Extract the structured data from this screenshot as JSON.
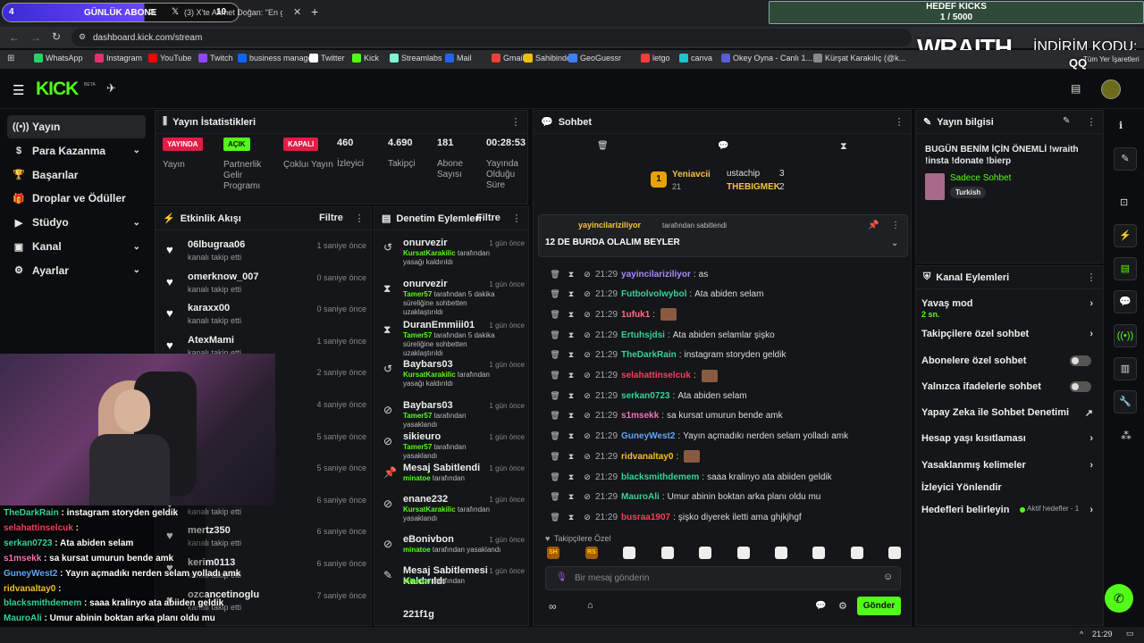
{
  "browser": {
    "tabs": [
      {
        "label": "GÜNLÜK ABONE"
      },
      {
        "label": "(3) X'te Ahmet Doğan: \"En gü..."
      }
    ],
    "overlay_left_num": "4",
    "overlay_right_num": "10",
    "new_tab": "+",
    "url": "dashboard.kick.com/stream",
    "bookmarks": [
      "WhatsApp",
      "Instagram",
      "YouTube",
      "Twitch",
      "business manager",
      "Twitter",
      "Kick",
      "Streamlabs",
      "Mail",
      "Gmail",
      "Sahibinden",
      "GeoGuessr",
      "letgo",
      "canva",
      "Okey Oyna - Canlı 1...",
      "Kürşat Karakılıç (@k..."
    ],
    "bookmarks_right": "Tüm Yer İşaretleri"
  },
  "stream_overlay": {
    "goal_title": "HEDEF KICKS",
    "goal_value": "1 / 5000",
    "brand": "WRAITH.",
    "discount_label": "İNDİRİM KODU:",
    "discount_code": "QQ"
  },
  "kick": {
    "logo": "KICK",
    "beta": "BETA"
  },
  "nav": [
    {
      "label": "Yayın",
      "icon": "((•))",
      "chev": false
    },
    {
      "label": "Para Kazanma",
      "icon": "$",
      "chev": true
    },
    {
      "label": "Başarılar",
      "icon": "🏆",
      "chev": false
    },
    {
      "label": "Droplar ve Ödüller",
      "icon": "🎁",
      "chev": false
    },
    {
      "label": "Stüdyo",
      "icon": "▶",
      "chev": true
    },
    {
      "label": "Kanal",
      "icon": "▣",
      "chev": true
    },
    {
      "label": "Ayarlar",
      "icon": "⚙",
      "chev": true
    }
  ],
  "stats": {
    "title": "Yayın İstatistikleri",
    "items": [
      {
        "badge": "YAYINDA",
        "label": "Yayın"
      },
      {
        "badge": "AÇIK",
        "label": "Partnerlik Gelir Programı"
      },
      {
        "badge": "KAPALI",
        "label": "Çokluı Yayın"
      },
      {
        "value": "460",
        "label": "İzleyici"
      },
      {
        "value": "4.690",
        "label": "Takipçi"
      },
      {
        "value": "181",
        "label": "Abone Sayısı"
      },
      {
        "value": "00:28:53",
        "label": "Yayında Olduğu Süre"
      }
    ]
  },
  "activity": {
    "title": "Etkinlik Akışı",
    "filter": "Filtre",
    "items": [
      {
        "name": "06lbugraa06",
        "sub": "kanalı takip etti",
        "time": "1 saniye önce"
      },
      {
        "name": "omerknow_007",
        "sub": "kanalı takip etti",
        "time": "0 saniye önce"
      },
      {
        "name": "karaxx00",
        "sub": "kanalı takip etti",
        "time": "0 saniye önce"
      },
      {
        "name": "AtexMami",
        "sub": "kanalı takip etti",
        "time": "1 saniye önce"
      },
      {
        "name": "",
        "sub": "",
        "time": "2 saniye önce"
      },
      {
        "name": "",
        "sub": "",
        "time": "4 saniye önce"
      },
      {
        "name": "",
        "sub": "",
        "time": "5 saniye önce"
      },
      {
        "name": "",
        "sub": "",
        "time": "5 saniye önce"
      },
      {
        "name": "",
        "sub": "kanalı takip etti",
        "time": "6 saniye önce"
      },
      {
        "name": "mertz350",
        "sub": "kanalı takip etti",
        "time": "6 saniye önce"
      },
      {
        "name": "kerim0113",
        "sub": "kanalı takip etti",
        "time": "6 saniye önce"
      },
      {
        "name": "ozcancetinoglu",
        "sub": "kanalı takip etti",
        "time": "7 saniye önce"
      }
    ]
  },
  "mod": {
    "title": "Denetim Eylemleri",
    "filter": "Filtre",
    "items": [
      {
        "icon": "↺",
        "name": "onurvezir",
        "by": "KursatKarakilic",
        "desc": " tarafından yasağı kaldırıldı",
        "time": "1 gün önce"
      },
      {
        "icon": "⧗",
        "name": "onurvezir",
        "by": "Tamer57",
        "desc": " tarafından 5 dakika süreliğine sohbetten uzaklaştırıldı",
        "time": "1 gün önce"
      },
      {
        "icon": "⧗",
        "name": "DuranEmmiii01",
        "by": "Tamer57",
        "desc": " tarafından 5 dakika süreliğine sohbetten uzaklaştırıldı",
        "time": "1 gün önce"
      },
      {
        "icon": "↺",
        "name": "Baybars03",
        "by": "KursatKarakilic",
        "desc": " tarafından yasağı kaldırıldı",
        "time": "1 gün önce"
      },
      {
        "icon": "⊘",
        "name": "Baybars03",
        "by": "Tamer57",
        "desc": " tarafından yasaklandı",
        "time": "1 gün önce"
      },
      {
        "icon": "⊘",
        "name": "sikieuro",
        "by": "Tamer57",
        "desc": " tarafından yasaklandı",
        "time": "1 gün önce"
      },
      {
        "icon": "📌",
        "name": "Mesaj Sabitlendi",
        "by": "minatoe",
        "desc": " tarafından",
        "time": "1 gün önce"
      },
      {
        "icon": "⊘",
        "name": "enane232",
        "by": "KursatKarakilic",
        "desc": " tarafından yasaklandı",
        "time": "1 gün önce"
      },
      {
        "icon": "⊘",
        "name": "eBonivbon",
        "by": "minatoe",
        "desc": " tarafından yasaklandı",
        "time": "1 gün önce"
      },
      {
        "icon": "✎",
        "name": "Mesaj Sabitlemesi Kaldırıldı",
        "by": "minatoe",
        "desc": " tarafından",
        "time": "1 gün önce"
      },
      {
        "icon": "",
        "name": "221f1g",
        "by": "",
        "desc": "",
        "time": ""
      }
    ]
  },
  "chat": {
    "title": "Sohbet",
    "leaderboard": [
      {
        "rank": "1",
        "name": "Yeniavcii",
        "count": "21"
      },
      {
        "name": "ustachip",
        "count": "3"
      },
      {
        "name": "THEBIGMEK",
        "count": "2"
      }
    ],
    "pinned_by": "yayincilariziliyor",
    "pinned_suffix": "tarafından sabitlendi",
    "pinned_msg": "12 DE BURDA OLALIM BEYLER",
    "messages": [
      {
        "time": "21:29",
        "user": "yayincilariziliyor",
        "color": "#a78bfa",
        "text": "as",
        "emote": false
      },
      {
        "time": "21:29",
        "user": "Futbolvolwybol",
        "color": "#34d399",
        "text": "Ata abiden selam",
        "emote": false
      },
      {
        "time": "21:29",
        "user": "1ufuk1",
        "color": "#fb7185",
        "text": "",
        "emote": true
      },
      {
        "time": "21:29",
        "user": "Ertuhsjdsi",
        "color": "#34d399",
        "text": "Ata abiden selamlar şişko",
        "emote": false
      },
      {
        "time": "21:29",
        "user": "TheDarkRain",
        "color": "#34d399",
        "text": "instagram storyden geldik",
        "emote": false
      },
      {
        "time": "21:29",
        "user": "selahattinselcuk",
        "color": "#f43f5e",
        "text": "",
        "emote": true
      },
      {
        "time": "21:29",
        "user": "serkan0723",
        "color": "#34d399",
        "text": "Ata abiden selam",
        "emote": false
      },
      {
        "time": "21:29",
        "user": "s1msekk",
        "color": "#f472b6",
        "text": "sa kursat umurun bende amk",
        "emote": false
      },
      {
        "time": "21:29",
        "user": "GuneyWest2",
        "color": "#60a5fa",
        "text": "Yayın açmadıkı nerden selam yolladı amk",
        "emote": false
      },
      {
        "time": "21:29",
        "user": "ridvanaltay0",
        "color": "#fbbf24",
        "text": "",
        "emote": true
      },
      {
        "time": "21:29",
        "user": "blacksmithdemem",
        "color": "#34d399",
        "text": "saaa kralinyo ata abiiden geldik",
        "emote": false
      },
      {
        "time": "21:29",
        "user": "MauroAli",
        "color": "#34d399",
        "text": "Umur abinin boktan arka planı oldu mu",
        "emote": false
      },
      {
        "time": "21:29",
        "user": "busraa1907",
        "color": "#f43f5e",
        "text": "şişko diyerek iletti ama ghjkjhgf",
        "emote": false
      }
    ],
    "followers_only": "Takipçilere Özel",
    "emote_tags": [
      "SH",
      "RS"
    ],
    "input_placeholder": "Bir mesaj gönderin",
    "send": "Gönder"
  },
  "stream_info": {
    "title": "Yayın bilgisi",
    "text": "BUGÜN BENİM İÇİN ÖNEMLİ !wraith !insta !donate !bierp",
    "category": "Sadece Sohbet",
    "language": "Turkish"
  },
  "channel_actions": {
    "title": "Kanal Eylemleri",
    "items": [
      {
        "label": "Yavaş mod",
        "sub": "2 sn.",
        "kind": "arrow"
      },
      {
        "label": "Takipçilere özel sohbet",
        "kind": "arrow"
      },
      {
        "label": "Abonelere özel sohbet",
        "kind": "toggle"
      },
      {
        "label": "Yalnızca ifadelerle sohbet",
        "kind": "toggle"
      },
      {
        "label": "Yapay Zeka ile Sohbet Denetimi",
        "kind": "ext"
      },
      {
        "label": "Hesap yaşı kısıtlaması",
        "kind": "arrow"
      },
      {
        "label": "Yasaklanmış kelimeler",
        "kind": "arrow"
      },
      {
        "label": "İzleyici Yönlendir",
        "kind": "none"
      },
      {
        "label": "Hedefleri belirleyin",
        "sub": "Aktif hedefler - 1",
        "kind": "arrow"
      }
    ]
  },
  "overlay_chat": [
    {
      "user": "TheDarkRain",
      "color": "#34d399",
      "text": " : instagram storyden geldik"
    },
    {
      "user": "selahattinselcuk",
      "color": "#f43f5e",
      "text": " :"
    },
    {
      "user": "serkan0723",
      "color": "#34d399",
      "text": " : Ata abiden selam"
    },
    {
      "user": "s1msekk",
      "color": "#f472b6",
      "text": " : sa kursat umurun bende amk"
    },
    {
      "user": "GuneyWest2",
      "color": "#60a5fa",
      "text": " : Yayın açmadıkı nerden selam yolladı amk"
    },
    {
      "user": "ridvanaltay0",
      "color": "#fbbf24",
      "text": " :"
    },
    {
      "user": "blacksmithdemem",
      "color": "#34d399",
      "text": " : saaa kralinyo ata abiiden geldik"
    },
    {
      "user": "MauroAli",
      "color": "#34d399",
      "text": " : Umur abinin boktan arka planı oldu mu"
    },
    {
      "user": "busraa1907",
      "color": "#f43f5e",
      "text": " : şişko diyerek iletti ama ghjkjhgf"
    }
  ],
  "clock": "21:29",
  "colors": {
    "accent": "#53fc18",
    "live": "#e11d48"
  }
}
